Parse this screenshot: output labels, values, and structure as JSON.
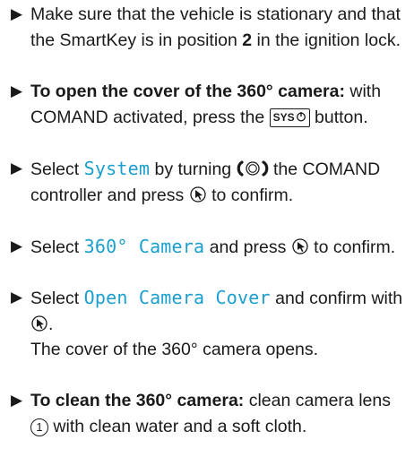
{
  "steps": [
    {
      "text_a": "Make sure that the vehicle is stationary and that the SmartKey is in position ",
      "bold": "2",
      "text_b": " in the ignition lock."
    },
    {
      "heading": "To open the cover of the 360° camera:",
      "text_a": " with COMAND activated, press the ",
      "key": "SYS",
      "text_b": " button."
    },
    {
      "text_a": "Select ",
      "menu": "System",
      "text_b": " by turning ",
      "text_c": " the COMAND controller and press ",
      "text_d": " to confirm."
    },
    {
      "text_a": "Select ",
      "menu": "360° Camera",
      "text_b": " and press ",
      "text_c": " to confirm."
    },
    {
      "text_a": "Select ",
      "menu": "Open Camera Cover",
      "text_b": " and confirm with ",
      "text_c": ".",
      "result": "The cover of the 360° camera opens."
    },
    {
      "heading": "To clean the 360° camera:",
      "text_a": " clean camera lens ",
      "callout": "1",
      "text_b": " with clean water and a soft cloth."
    }
  ],
  "icons": {
    "bullet": "triangle-bullet-icon",
    "rotate": "controller-rotate-icon",
    "press": "controller-press-icon",
    "sys_key": "sys-button-icon"
  }
}
